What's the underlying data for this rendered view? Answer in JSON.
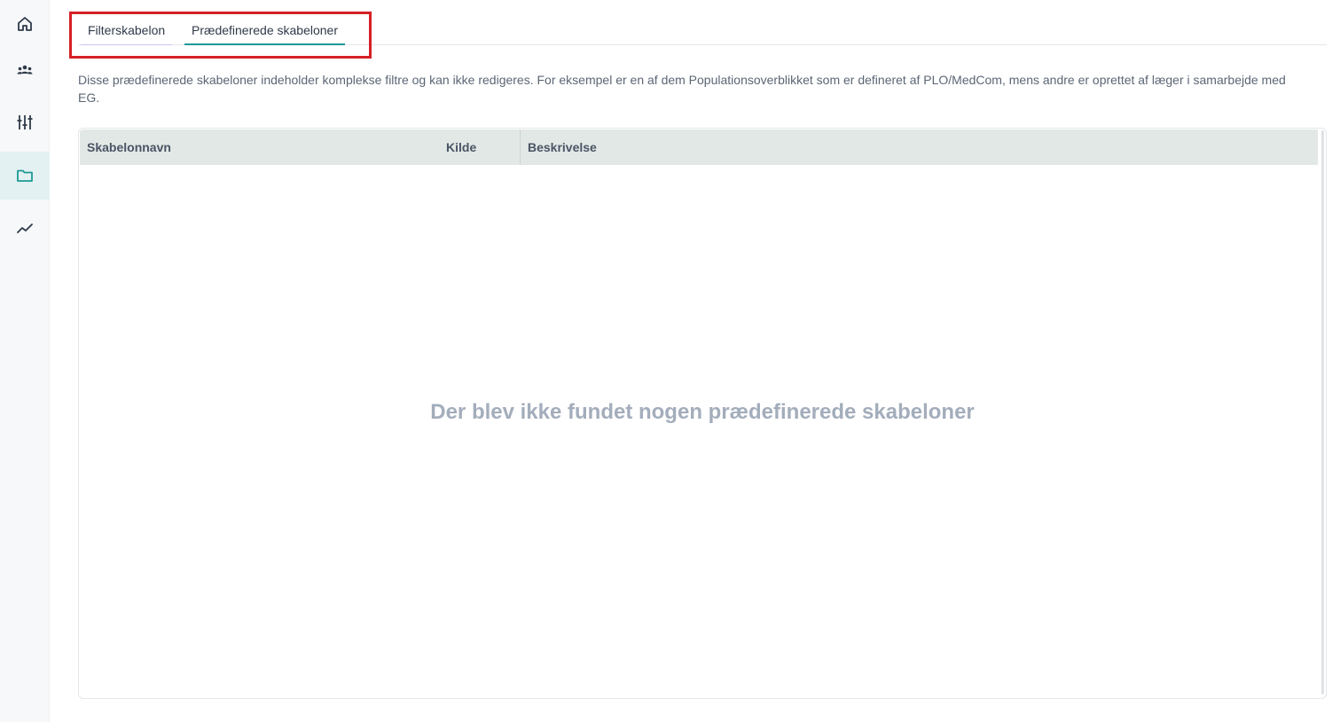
{
  "sidebar": {
    "items": [
      {
        "icon": "home-icon",
        "active": false
      },
      {
        "icon": "users-icon",
        "active": false
      },
      {
        "icon": "sliders-icon",
        "active": false
      },
      {
        "icon": "folder-icon",
        "active": true
      },
      {
        "icon": "trend-line-icon",
        "active": false
      }
    ]
  },
  "tabs": [
    {
      "label": "Filterskabelon",
      "active": false
    },
    {
      "label": "Prædefinerede skabeloner",
      "active": true
    }
  ],
  "description": "Disse prædefinerede skabeloner indeholder komplekse filtre og kan ikke redigeres. For eksempel er en af dem Populationsoverblikket som er defineret af PLO/MedCom, mens andre er oprettet af læger i samarbejde med EG.",
  "table": {
    "columns": [
      "Skabelonnavn",
      "Kilde",
      "Beskrivelse"
    ],
    "rows": [],
    "empty_message": "Der blev ikke fundet nogen prædefinerede skabeloner"
  },
  "colors": {
    "accent": "#1b9a94",
    "highlight_box": "#d61f26",
    "header_bg": "#e2e8e6",
    "sidebar_active": "#e3f1f2",
    "empty_text": "#a3adbb"
  }
}
